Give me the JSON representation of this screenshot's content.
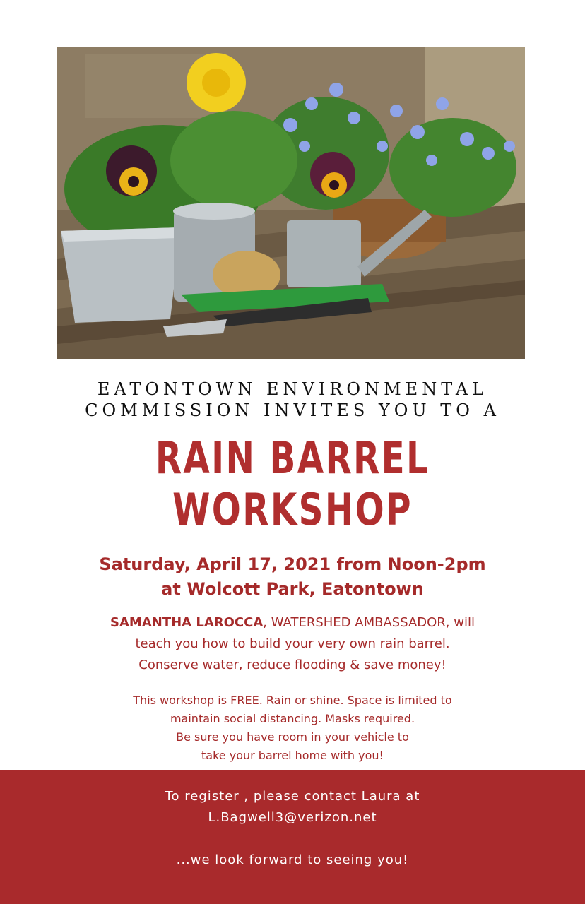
{
  "photo": {
    "subject": "potted-flowers-garden-photo"
  },
  "intro": {
    "line1": "EATONTOWN ENVIRONMENTAL",
    "line2": "COMMISSION INVITES YOU TO A"
  },
  "title": {
    "line1": "RAIN BARREL",
    "line2": "WORKSHOP"
  },
  "when": {
    "date": "Saturday, April 17, 2021 from Noon-2pm",
    "place": "at Wolcott Park, Eatontown"
  },
  "host": {
    "name": "SAMANTHA LAROCCA",
    "line1_rest": ", WATERSHED AMBASSADOR, will",
    "line2": "teach you how to  build your very own rain barrel.",
    "line3": "Conserve water, reduce flooding & save money!"
  },
  "details": {
    "line1": "This workshop is FREE. Rain or shine. Space is limited to",
    "line2": "maintain social distancing.  Masks required.",
    "line3": "Be sure you have room in your vehicle to",
    "line4": "take your barrel home with you!"
  },
  "footer": {
    "register": "To register , please contact Laura at",
    "email": "L.Bagwell3@verizon.net",
    "closing": "...we look forward to seeing you!"
  },
  "colors": {
    "accent": "#a92a2c",
    "title": "#b02e2e",
    "text": "#a52a2a"
  }
}
